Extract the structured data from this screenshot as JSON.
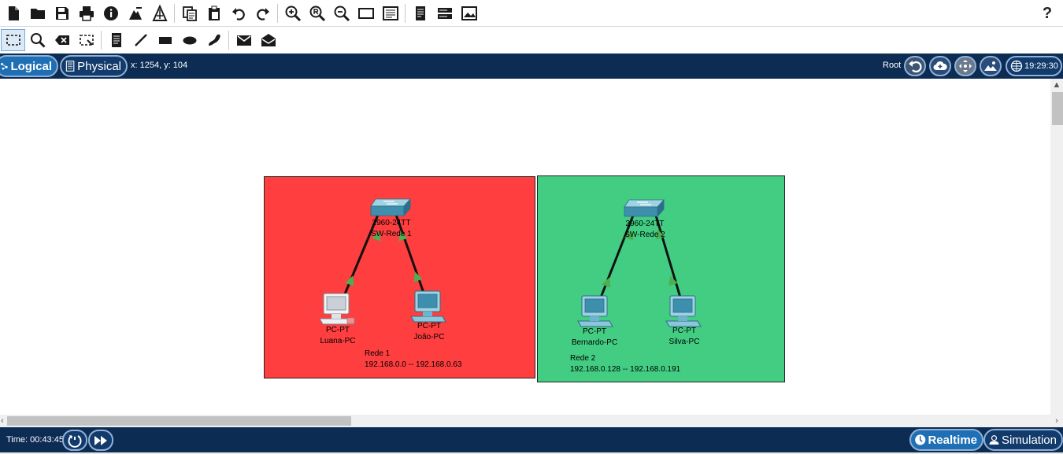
{
  "colors": {
    "toolbar_bg": "#ffffff",
    "navbar_bg": "#0d2c54",
    "active_tab": "#1f6fb5",
    "rede1_area": "#fe3e3f",
    "rede2_area": "#42cd83",
    "link_up": "#4caf50"
  },
  "toolbar_main": {
    "icons": [
      "new-file-icon",
      "open-folder-icon",
      "save-icon",
      "print-icon",
      "info-icon",
      "activity-wizard-icon",
      "custom-device-icon",
      "copy-icon",
      "paste-icon",
      "undo-icon",
      "redo-icon",
      "zoom-in-icon",
      "zoom-reset-icon",
      "zoom-out-icon",
      "drawing-palette-icon",
      "custom-devices-dialog-icon",
      "viewport-icon",
      "network-info-icon",
      "image-icon"
    ],
    "help": "?"
  },
  "toolbar_draw": {
    "icons": [
      "select-icon",
      "inspect-icon",
      "delete-icon",
      "resize-shape-icon",
      "note-icon",
      "line-icon",
      "rectangle-icon",
      "ellipse-icon",
      "freeform-icon",
      "simple-pdu-icon",
      "complex-pdu-icon"
    ]
  },
  "navbar": {
    "logical_label": "Logical",
    "physical_label": "Physical",
    "coordinates": "x: 1254, y: 104",
    "root_label": "Root",
    "clock": "19:29:30"
  },
  "workspace": {
    "areas": [
      {
        "name": "Rede 1",
        "range": "192.168.0.0 -- 192.168.0.63"
      },
      {
        "name": "Rede 2",
        "range": "192.168.0.128 -- 192.168.0.191"
      }
    ],
    "switches": [
      {
        "model": "2960-24TT",
        "name": "SW-Rede 1"
      },
      {
        "model": "2960-24TT",
        "name": "SW-Rede 2"
      }
    ],
    "pcs": [
      {
        "model": "PC-PT",
        "name": "Luana-PC"
      },
      {
        "model": "PC-PT",
        "name": "João-PC"
      },
      {
        "model": "PC-PT",
        "name": "Bernardo-PC"
      },
      {
        "model": "PC-PT",
        "name": "Silva-PC"
      }
    ]
  },
  "bottombar": {
    "time": "Time: 00:43:45",
    "realtime_label": "Realtime",
    "simulation_label": "Simulation"
  }
}
